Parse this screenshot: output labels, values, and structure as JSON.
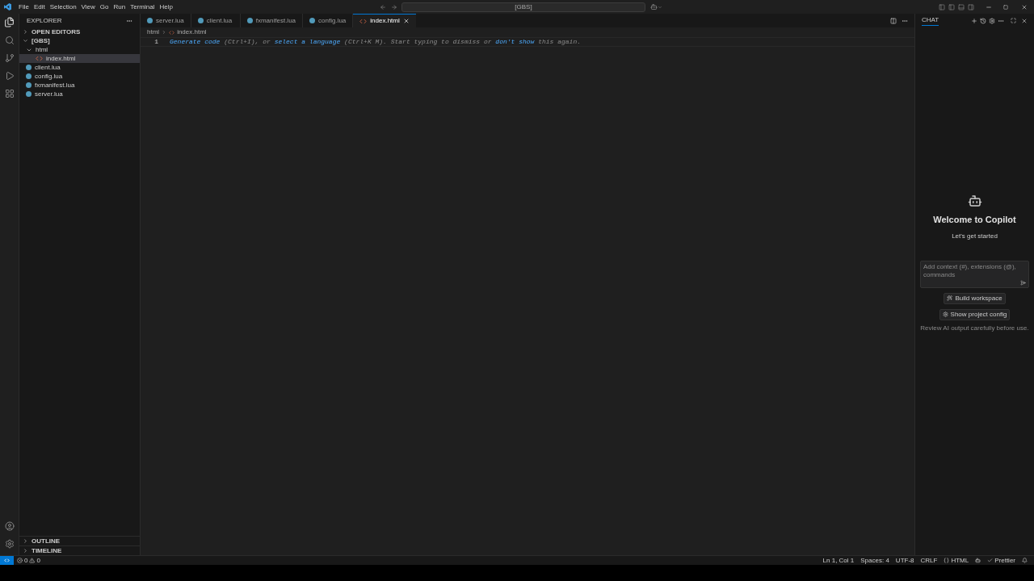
{
  "menu": [
    "File",
    "Edit",
    "Selection",
    "View",
    "Go",
    "Run",
    "Terminal",
    "Help"
  ],
  "search": {
    "value": "[GBS]"
  },
  "sidebar": {
    "title": "EXPLORER",
    "open_editors": {
      "label": "OPEN EDITORS",
      "expanded": false
    },
    "tree": {
      "label": "[GBS]",
      "expanded": true,
      "children": [
        {
          "label": "html",
          "kind": "folder",
          "expanded": true,
          "selected": false,
          "children": [
            {
              "label": "index.html",
              "kind": "html",
              "selected": true
            }
          ]
        },
        {
          "label": "client.lua",
          "kind": "lua",
          "selected": false
        },
        {
          "label": "config.lua",
          "kind": "lua",
          "selected": false
        },
        {
          "label": "fxmanifest.lua",
          "kind": "lua",
          "selected": false
        },
        {
          "label": "server.lua",
          "kind": "lua",
          "selected": false
        }
      ]
    },
    "bottom_sections": [
      {
        "label": "OUTLINE",
        "expanded": false
      },
      {
        "label": "TIMELINE",
        "expanded": false
      }
    ]
  },
  "tabs": [
    {
      "label": "server.lua",
      "kind": "lua",
      "selected": false
    },
    {
      "label": "client.lua",
      "kind": "lua",
      "selected": false
    },
    {
      "label": "fxmanifest.lua",
      "kind": "lua",
      "selected": false
    },
    {
      "label": "config.lua",
      "kind": "lua",
      "selected": false
    },
    {
      "label": "index.html",
      "kind": "html",
      "selected": true
    }
  ],
  "breadcrumb": [
    "html",
    "index.html"
  ],
  "editor": {
    "line_number": "1",
    "hint": [
      {
        "text": "Generate code",
        "link": true
      },
      {
        "text": "(Ctrl+I), or",
        "link": false
      },
      {
        "text": "select a language",
        "link": true
      },
      {
        "text": "(Ctrl+K M). Start typing to dismiss or",
        "link": false
      },
      {
        "text": "don't show",
        "link": true
      },
      {
        "text": "this again.",
        "link": false
      }
    ]
  },
  "chat": {
    "tab": "CHAT",
    "title": "Welcome to Copilot",
    "subtitle": "Let's get started",
    "input_placeholder": "Add context (#), extensions (@), commands",
    "buttons": [
      {
        "label": "Build workspace",
        "kind": "build"
      },
      {
        "label": "Show project config",
        "kind": "config"
      }
    ],
    "disclaimer": "Review AI output carefully before use."
  },
  "status_bar": {
    "errors": "0",
    "warnings": "0",
    "items": [
      {
        "text": "Ln 1, Col 1",
        "kind": "plain"
      },
      {
        "text": "Spaces: 4",
        "kind": "plain"
      },
      {
        "text": "UTF-8",
        "kind": "plain"
      },
      {
        "text": "CRLF",
        "kind": "plain"
      },
      {
        "text": "HTML",
        "kind": "language"
      },
      {
        "text": "Prettier",
        "kind": "check"
      }
    ]
  }
}
